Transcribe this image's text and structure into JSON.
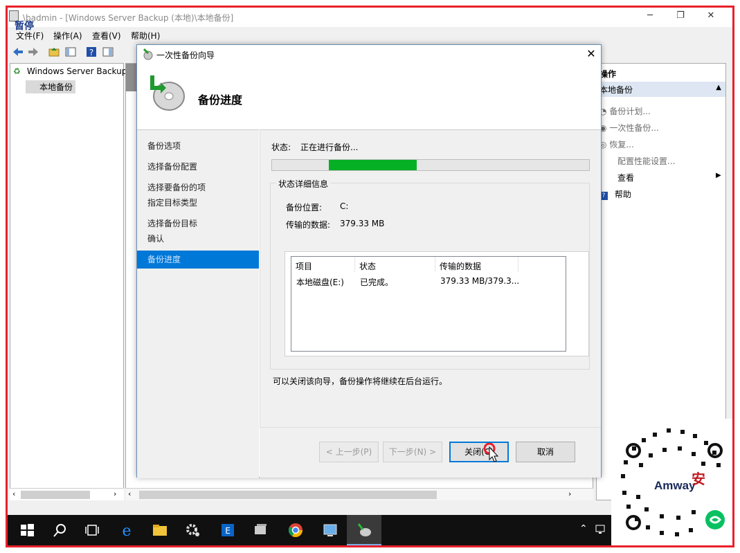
{
  "mmc": {
    "title": "\\badmin - [Windows Server Backup (本地)\\本地备份]",
    "pause_label": "暂停",
    "menu": [
      "文件(F)",
      "操作(A)",
      "查看(V)",
      "帮助(H)"
    ],
    "tree_root": "Windows Server Backup",
    "tree_child": "本地备份"
  },
  "actions": {
    "header": "操作",
    "section": "本地备份",
    "items": [
      "备份计划...",
      "一次性备份...",
      "恢复...",
      "配置性能设置...",
      "查看",
      "帮助"
    ]
  },
  "wizard": {
    "title": "一次性备份向导",
    "heading": "备份进度",
    "steps": [
      "备份选项",
      "选择备份配置",
      "选择要备份的项",
      "指定目标类型",
      "选择备份目标",
      "确认",
      "备份进度"
    ],
    "active_step": 6,
    "status_label": "状态:",
    "status_value": "正在进行备份...",
    "progress_fraction": 0.277,
    "progress_start_fraction": 0.178,
    "details_legend": "状态详细信息",
    "location_label": "备份位置:",
    "location_value": "C:",
    "transferred_label": "传输的数据:",
    "transferred_value": "379.33 MB",
    "tab_label": "项目",
    "columns": [
      "项目",
      "状态",
      "传输的数据"
    ],
    "rows": [
      {
        "item": "本地磁盘(E:)",
        "status": "已完成。",
        "data": "379.33 MB/379.3..."
      }
    ],
    "note": "可以关闭该向导，备份操作将继续在后台运行。",
    "buttons": {
      "back": "< 上一步(P)",
      "next": "下一步(N) >",
      "close": "关闭(C)",
      "cancel": "取消"
    }
  },
  "watermark": {
    "brand": "Amway",
    "seal": "安利"
  },
  "colors": {
    "frame": "#e8202a",
    "progress": "#06b025",
    "active_step": "#0078d7"
  }
}
